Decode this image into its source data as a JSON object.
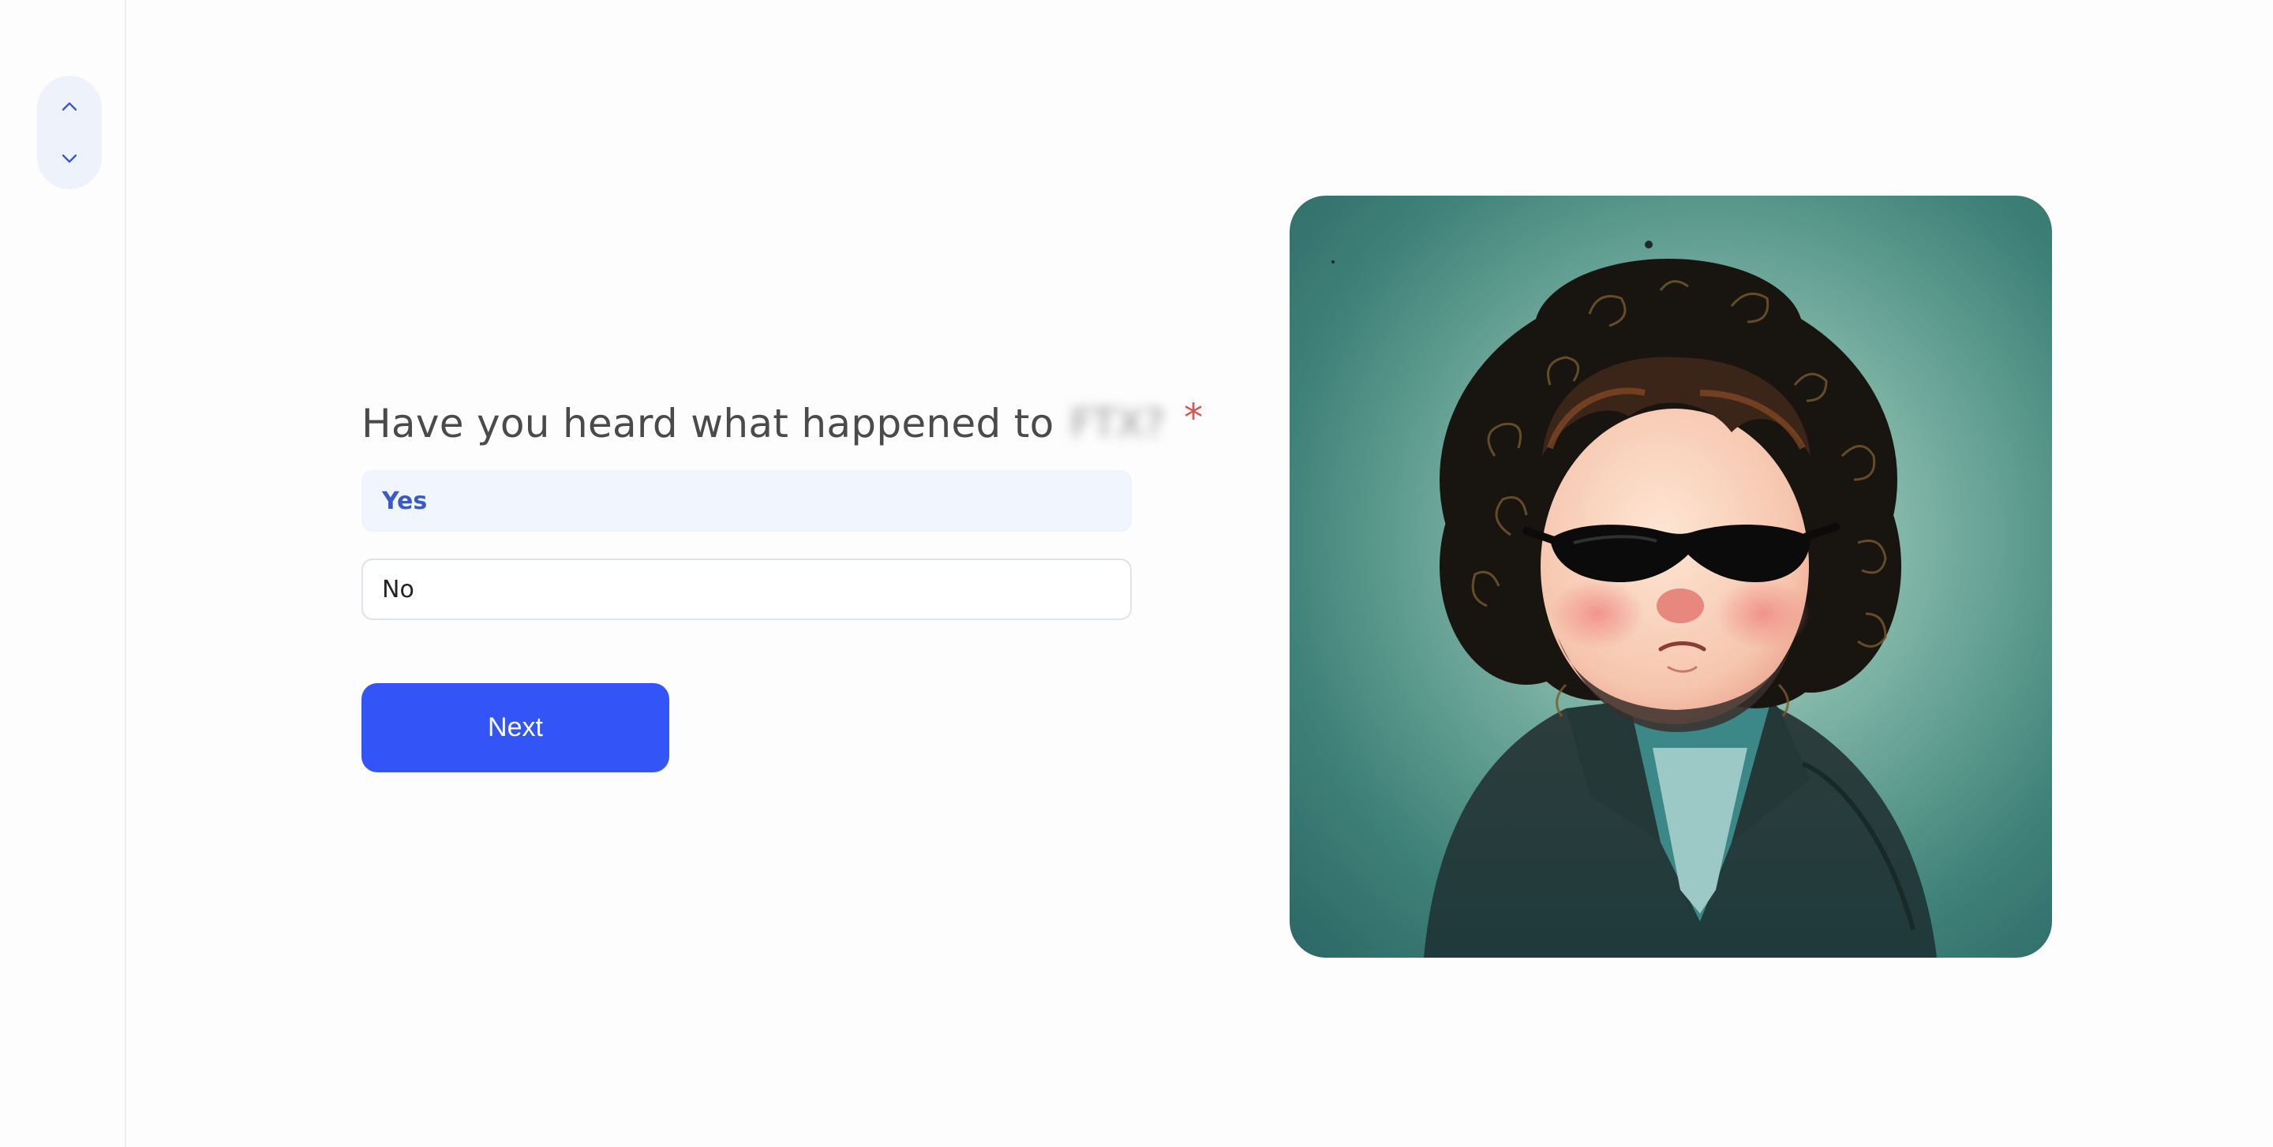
{
  "navigation": {
    "up_icon": "chevron-up-icon",
    "down_icon": "chevron-down-icon"
  },
  "question": {
    "text": "Have you heard what happened to",
    "redacted_text": "FTX?",
    "required_marker": "*"
  },
  "options": [
    {
      "label": "Yes",
      "selected": true
    },
    {
      "label": "No",
      "selected": false
    }
  ],
  "next_button": {
    "label": "Next"
  },
  "colors": {
    "accent": "#3355f8",
    "selected_option_text": "#3a5bc7",
    "selected_option_bg": "#f1f5fd",
    "required": "#d9534f",
    "illustration_bg": "#3f8279"
  },
  "illustration": {
    "icon": "cartoon-portrait-image"
  }
}
